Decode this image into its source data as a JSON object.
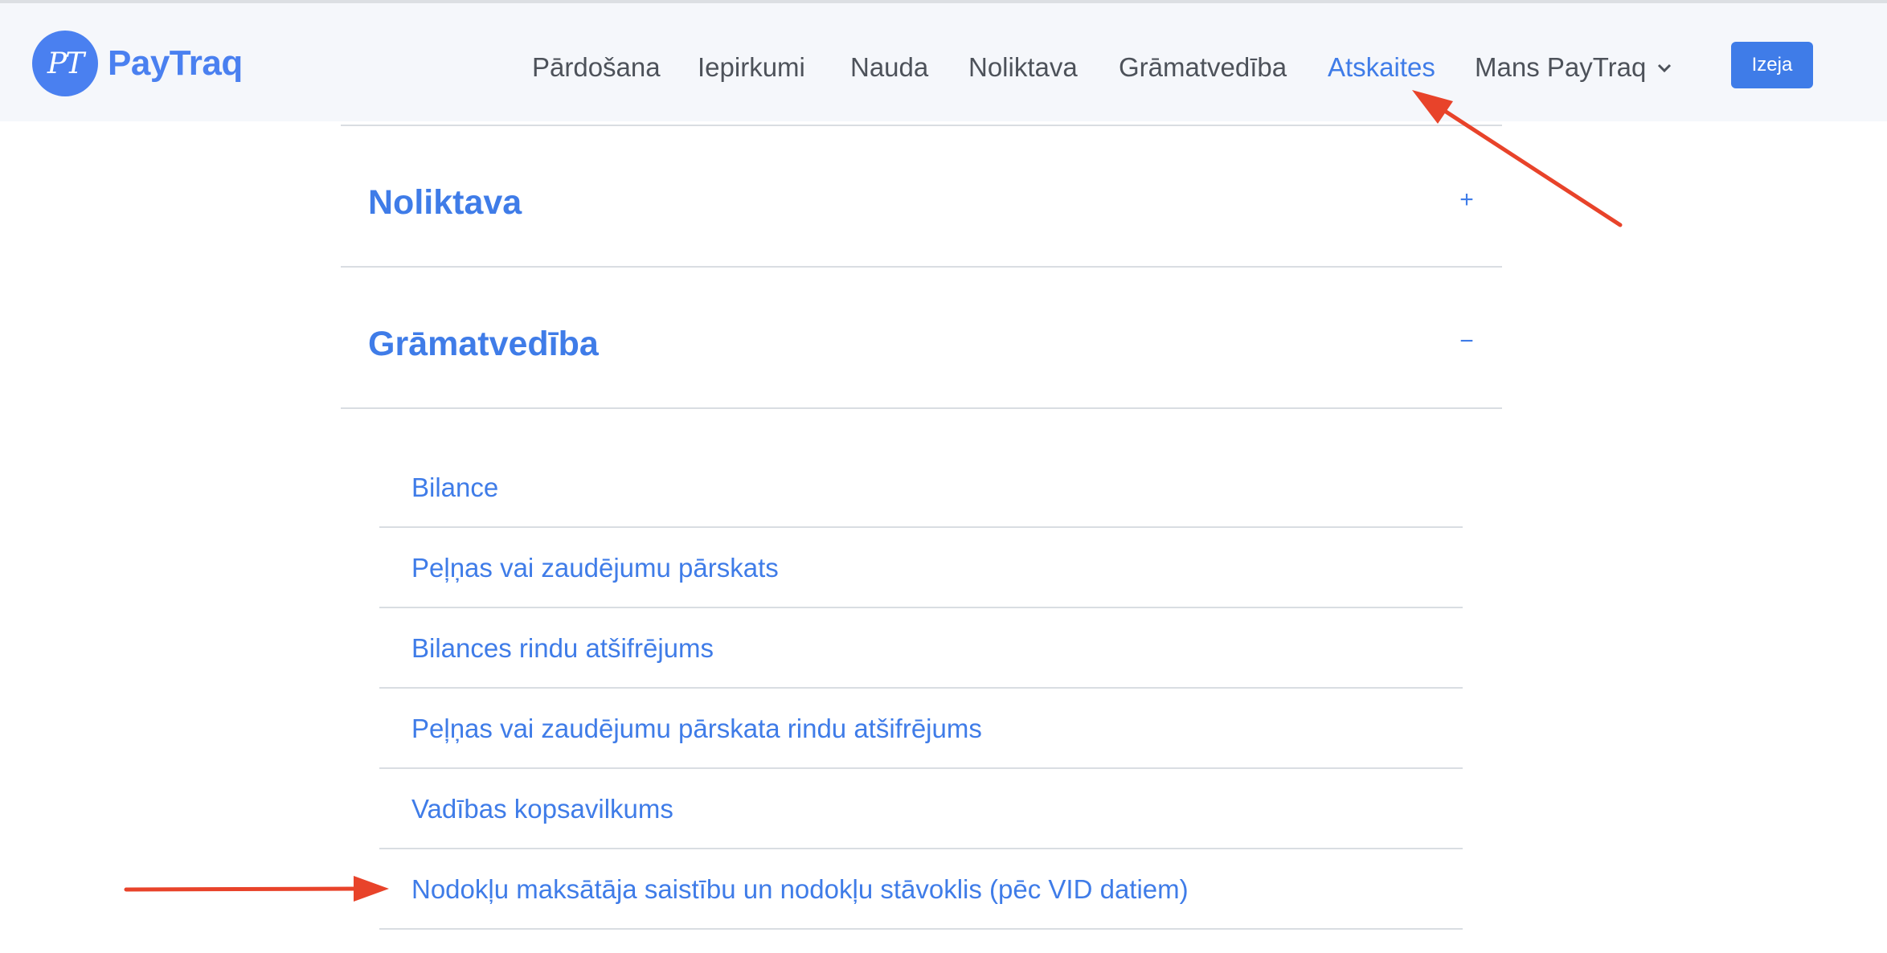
{
  "app": {
    "logo_mark": "PT",
    "logo_text": "PayTraq"
  },
  "nav": {
    "items": [
      "Pārdošana",
      "Iepirkumi",
      "Nauda",
      "Noliktava",
      "Grāmatvedība",
      "Atskaites",
      "Mans PayTraq"
    ],
    "active": "Atskaites",
    "logout_label": "Izeja",
    "dropdown_icon": "chevron-down-icon"
  },
  "sections": [
    {
      "title": "Noliktava",
      "toggle": "+",
      "expanded": false
    },
    {
      "title": "Grāmatvedība",
      "toggle": "−",
      "expanded": true
    }
  ],
  "reports": [
    "Bilance",
    "Peļņas vai zaudējumu pārskats",
    "Bilances rindu atšifrējums",
    "Peļņas vai zaudējumu pārskata rindu atšifrējums",
    "Vadības kopsavilkums",
    "Nodokļu maksātāja saistību un nodokļu stāvoklis (pēc VID datiem)"
  ],
  "colors": {
    "accent": "#3f7ce8",
    "header_bg": "#f5f7fb",
    "annotation_arrow": "#e8432a"
  }
}
